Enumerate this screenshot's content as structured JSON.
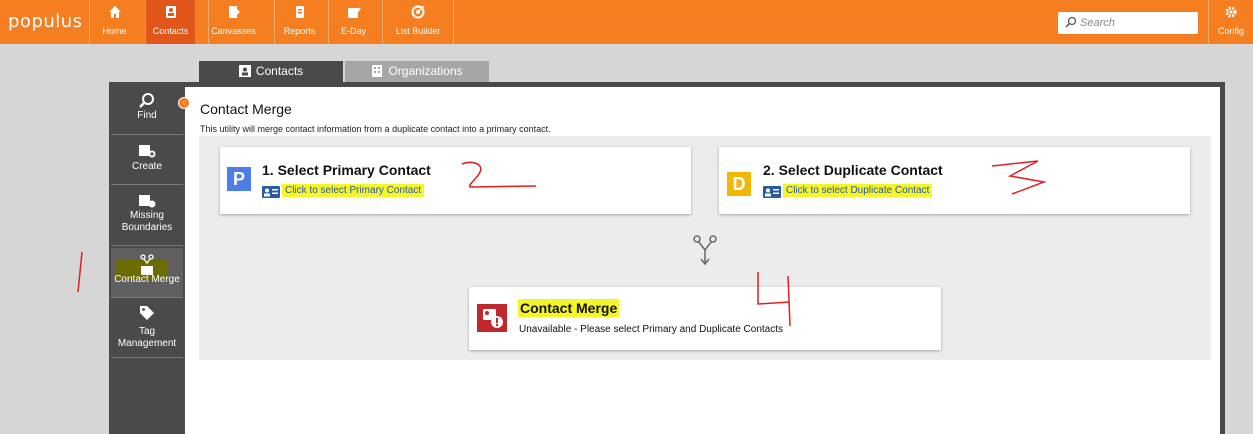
{
  "app": {
    "logo": "populus"
  },
  "nav": {
    "items": [
      {
        "label": "Home",
        "icon": "home-icon"
      },
      {
        "label": "Contacts",
        "icon": "contact-card-icon",
        "active": true
      },
      {
        "label": "Canvasses",
        "icon": "canvass-icon"
      },
      {
        "label": "Reports",
        "icon": "report-icon"
      },
      {
        "label": "E-Day",
        "icon": "calendar-check-icon"
      },
      {
        "label": "List Builder",
        "icon": "target-icon"
      }
    ],
    "search_placeholder": "Search",
    "config_label": "Config"
  },
  "tabs": [
    {
      "label": "Contacts",
      "active": true
    },
    {
      "label": "Organizations",
      "active": false
    }
  ],
  "sidebar": {
    "items": [
      {
        "label": "Find"
      },
      {
        "label": "Create"
      },
      {
        "label": "Missing Boundaries"
      },
      {
        "label": "Contact Merge",
        "active": true
      },
      {
        "label": "Tag Management"
      }
    ]
  },
  "main": {
    "title": "Contact Merge",
    "description": "This utility will merge contact information from a duplicate contact into a primary contact.",
    "primary": {
      "badge": "P",
      "title": "1. Select Primary Contact",
      "link": "Click to select Primary Contact"
    },
    "duplicate": {
      "badge": "D",
      "title": "2. Select Duplicate Contact",
      "link": "Click to select Duplicate Contact"
    },
    "merge": {
      "title": "Contact Merge",
      "status": "Unavailable - Please select Primary and Duplicate Contacts"
    }
  },
  "annotations": {
    "a1": "1",
    "a2": "2",
    "a3": "3",
    "a4": "4"
  },
  "colors": {
    "brand": "#f57e20",
    "active_nav": "#e2561b",
    "primary_badge": "#4d7de8",
    "duplicate_badge": "#f2b705",
    "merge_badge": "#c0282c",
    "highlight": "#f5f52a",
    "annotation": "#e02020"
  }
}
